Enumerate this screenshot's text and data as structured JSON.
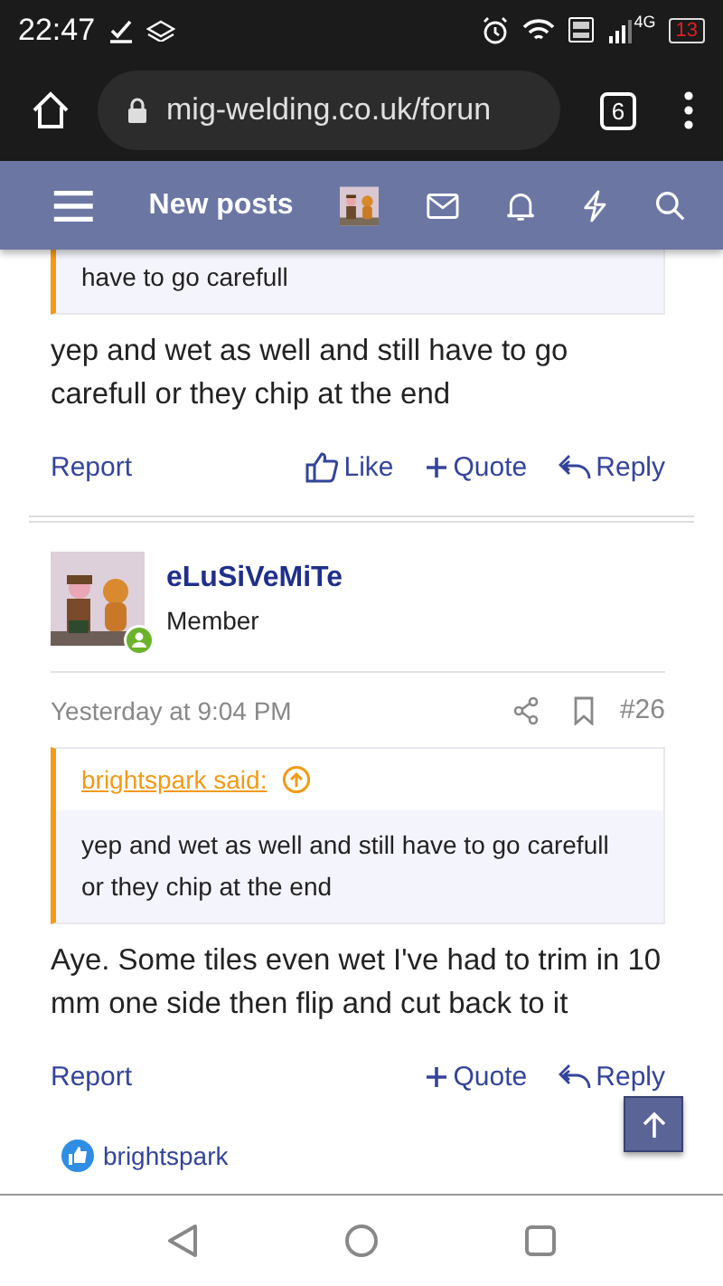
{
  "status_bar": {
    "time": "22:47",
    "network": "4G",
    "battery": "13"
  },
  "browser": {
    "url": "mig-welding.co.uk/forun",
    "tab_count": "6"
  },
  "nav": {
    "title": "New posts"
  },
  "posts": [
    {
      "quote": {
        "body": "have to go carefull"
      },
      "text": "yep and wet as well and still have to go carefull or they chip at the end",
      "actions": [
        {
          "kind": "report",
          "label": "Report"
        },
        {
          "kind": "like",
          "label": "Like"
        },
        {
          "kind": "quote",
          "label": "Quote"
        },
        {
          "kind": "reply",
          "label": "Reply"
        }
      ]
    },
    {
      "author": "eLuSiVeMiTe",
      "role": "Member",
      "date": "Yesterday at 9:04 PM",
      "number": "#26",
      "quote": {
        "source": "brightspark said:",
        "body": "yep and wet as well and still have to go carefull or they chip at the end"
      },
      "text": "Aye. Some tiles even wet I've had to trim in 10 mm one side then flip and cut back to it",
      "actions": [
        {
          "kind": "report",
          "label": "Report"
        },
        {
          "kind": "quote",
          "label": "Quote"
        },
        {
          "kind": "reply",
          "label": "Reply"
        }
      ],
      "reactions": [
        "brightspark"
      ]
    }
  ]
}
